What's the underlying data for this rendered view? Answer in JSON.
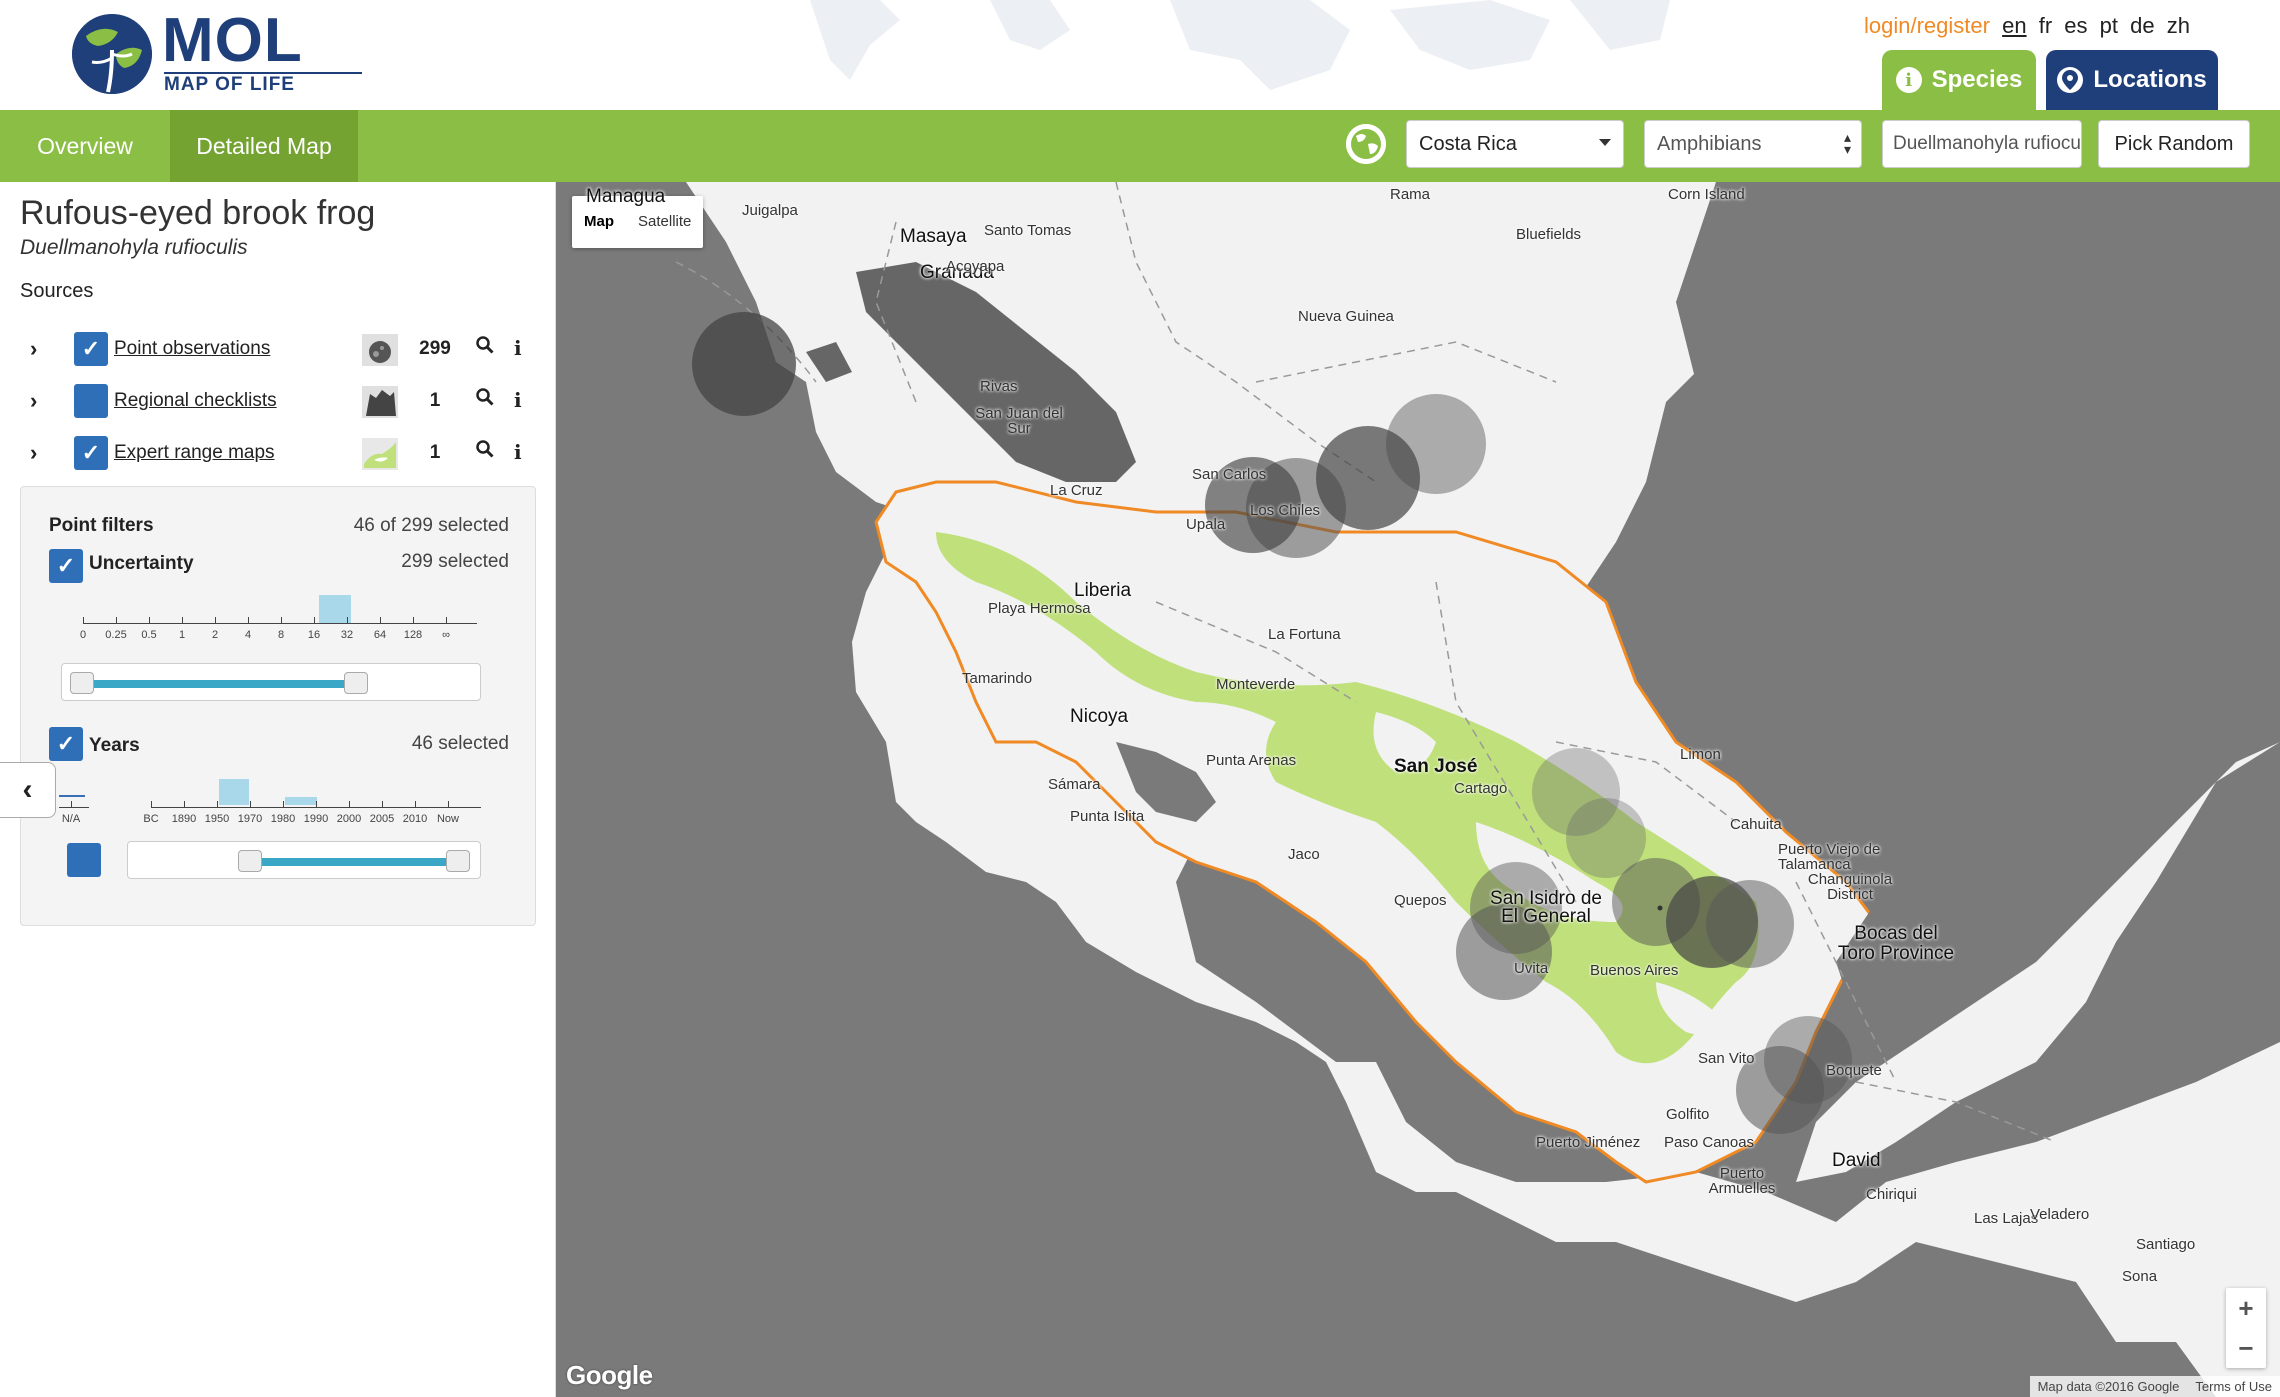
{
  "app": {
    "logo_big": "MOL",
    "logo_small": "MAP OF LIFE"
  },
  "top_links": {
    "login": "login/register",
    "languages": [
      "en",
      "fr",
      "es",
      "pt",
      "de",
      "zh"
    ],
    "active_language": "en"
  },
  "tabs": {
    "species": "Species",
    "locations": "Locations"
  },
  "nav": {
    "overview": "Overview",
    "detailed_map": "Detailed Map",
    "country_select": "Costa Rica",
    "class_select": "Amphibians",
    "species_input": "Duellmanohyla rufioculis",
    "pick_random": "Pick Random"
  },
  "species": {
    "common_name": "Rufous-eyed brook frog",
    "scientific_name": "Duellmanohyla rufioculis"
  },
  "sources": {
    "heading": "Sources",
    "rows": [
      {
        "label": "Point observations",
        "count": "299",
        "checked": true,
        "icon": "point-observations-thumbnail"
      },
      {
        "label": "Regional checklists",
        "count": "1",
        "checked": false,
        "icon": "regional-checklists-thumbnail"
      },
      {
        "label": "Expert range maps",
        "count": "1",
        "checked": true,
        "icon": "expert-range-maps-thumbnail"
      }
    ]
  },
  "filters": {
    "title": "Point filters",
    "selected_summary": "46 of 299 selected",
    "uncertainty": {
      "label": "Uncertainty",
      "selected": "299 selected",
      "ticks": [
        "0",
        "0.25",
        "0.5",
        "1",
        "2",
        "4",
        "8",
        "16",
        "32",
        "64",
        "128",
        "∞"
      ]
    },
    "years": {
      "label": "Years",
      "selected": "46 selected",
      "na_tick": "N/A",
      "ticks": [
        "BC",
        "1890",
        "1950",
        "1970",
        "1980",
        "1990",
        "2000",
        "2005",
        "2010",
        "Now"
      ]
    }
  },
  "map": {
    "type_map": "Map",
    "type_satellite": "Satellite",
    "zoom_in": "+",
    "zoom_out": "−",
    "google": "Google",
    "attribution": "Map data ©2016 Google",
    "terms": "Terms of Use",
    "labels": {
      "managua": "Managua",
      "juigalpa": "Juigalpa",
      "rama": "Rama",
      "corn_island": "Corn Island",
      "masaya": "Masaya",
      "granada": "Granada",
      "santo_tomas": "Santo Tomas",
      "acoyapa": "Acoyapa",
      "bluefields": "Bluefields",
      "nueva_guinea": "Nueva Guinea",
      "rivas": "Rivas",
      "san_juan_del_sur": "San Juan del Sur",
      "san_carlos": "San Carlos",
      "la_cruz": "La Cruz",
      "upala": "Upala",
      "los_chiles": "Los Chiles",
      "liberia": "Liberia",
      "playa_hermosa": "Playa Hermosa",
      "la_fortuna": "La Fortuna",
      "monteverde": "Monteverde",
      "tamarindo": "Tamarindo",
      "nicoya": "Nicoya",
      "punta_arenas": "Punta Arenas",
      "san_jose": "San José",
      "cartago": "Cartago",
      "limon": "Limon",
      "samara": "Sámara",
      "punta_islita": "Punta Islita",
      "cahuita": "Cahuita",
      "puerto_viejo": "Puerto Viejo de Talamanca",
      "changuinola": "Changuinola District",
      "quepos": "Quepos",
      "san_isidro": "San Isidro de El General",
      "bocas_del_toro": "Bocas del Toro Province",
      "uvita": "Uvita",
      "buenos_aires": "Buenos Aires",
      "jaco": "Jaco",
      "san_vito": "San Vito",
      "boquete": "Boquete",
      "golfito": "Golfito",
      "puerto_jimenez": "Puerto Jiménez",
      "paso_canoas": "Paso Canoas",
      "puerto_armuelles": "Puerto Armuelles",
      "david": "David",
      "chiriqui": "Chiriqui",
      "las_lajas": "Las Lajas",
      "veladero": "Veladero",
      "santiago": "Santiago",
      "sona": "Sona"
    }
  },
  "colors": {
    "brand_green": "#8bbe44",
    "brand_blue": "#1f3f7a",
    "accent_orange": "#f08a24",
    "range_green": "#bfe07a"
  }
}
